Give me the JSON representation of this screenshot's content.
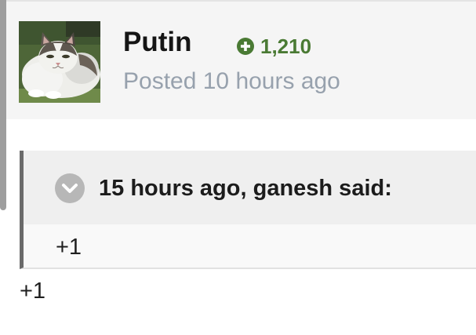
{
  "post": {
    "author": {
      "name": "Putin",
      "avatar_icon": "cat-avatar",
      "reputation": "1,210",
      "reputation_icon": "plus-circle-icon",
      "reputation_color": "#4a7a34"
    },
    "timestamp": "Posted 10 hours ago",
    "quote": {
      "citation": "15 hours ago, ganesh said:",
      "toggle_icon": "chevron-down-icon",
      "body": "+1"
    },
    "body": "+1"
  },
  "colors": {
    "header_bg": "#f5f5f5",
    "quote_bg": "#f9f9f9",
    "citation_bg": "#efefef",
    "quote_border": "#6a6a6a",
    "muted_text": "#97a1ad"
  }
}
